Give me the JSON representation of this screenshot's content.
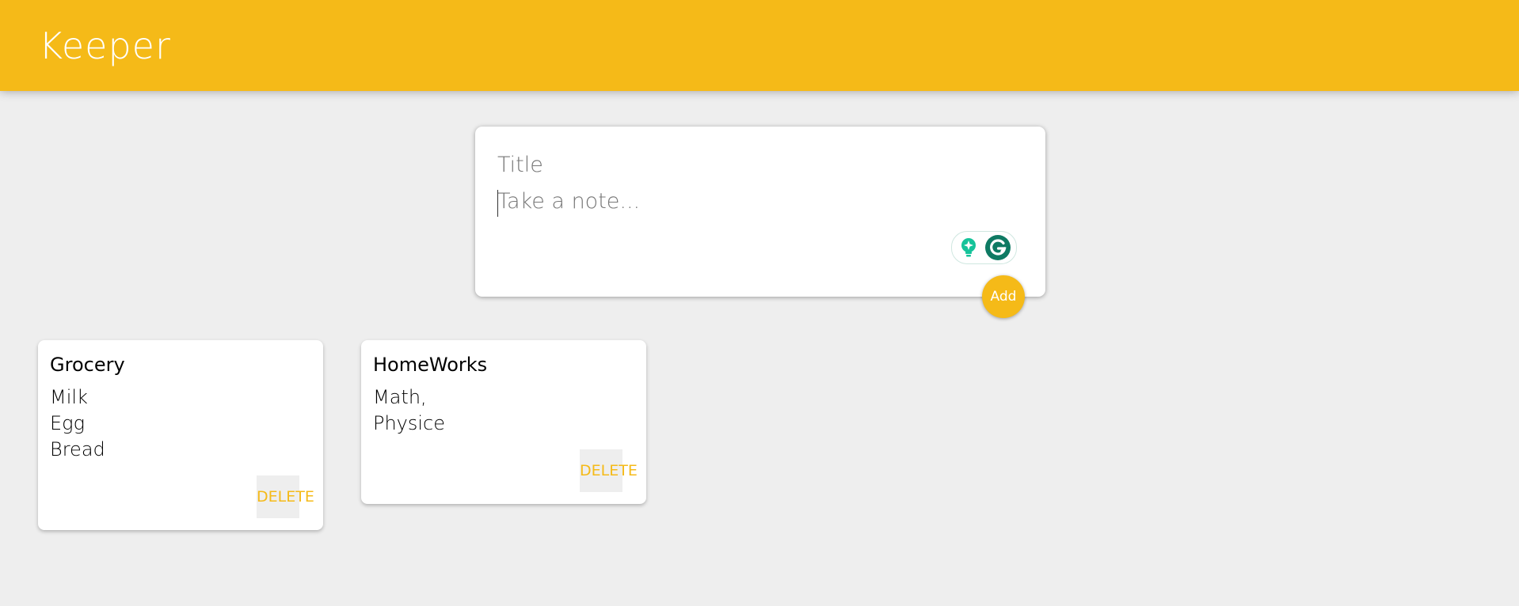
{
  "app": {
    "title": "Keeper",
    "accent_color": "#f5ba18",
    "background_color": "#eeeeee"
  },
  "create_area": {
    "title_placeholder": "Title",
    "content_placeholder": "Take a note...",
    "add_label": "Add",
    "extension_icons": [
      "grammarly-lightbulb-icon",
      "grammarly-logo-icon"
    ]
  },
  "notes": [
    {
      "title": "Grocery",
      "content": "Milk\nEgg\nBread",
      "delete_label": "DELETE"
    },
    {
      "title": "HomeWorks",
      "content": "Math,\nPhysice",
      "delete_label": "DELETE"
    }
  ]
}
